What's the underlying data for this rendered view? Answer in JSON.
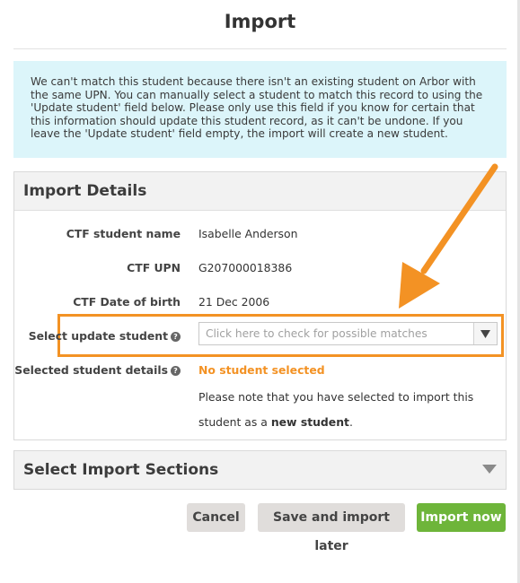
{
  "dialog": {
    "title": "Import",
    "notice": "We can't match this student because there isn't an existing student on Arbor with the same UPN. You can manually select a student to match this record to using the 'Update student' field below. Please only use this field if you know for certain that this information should update this student record, as it can't be undone. If you leave the 'Update student' field empty, the import will create a new student."
  },
  "details": {
    "heading": "Import Details",
    "rows": [
      {
        "label": "CTF student name",
        "value": "Isabelle Anderson"
      },
      {
        "label": "CTF UPN",
        "value": "G207000018386"
      },
      {
        "label": "CTF Date of birth",
        "value": "21 Dec 2006"
      }
    ],
    "update_student": {
      "label": "Select update student",
      "placeholder": "Click here to check for possible matches"
    },
    "selected": {
      "label": "Selected student details",
      "value": "No student selected",
      "note_prefix": "Please note that you have selected to import this student as a ",
      "note_bold": "new student",
      "note_suffix": "."
    }
  },
  "sections": {
    "heading": "Select Import Sections"
  },
  "buttons": {
    "cancel": "Cancel",
    "save_later": "Save and import later",
    "import_now": "Import now"
  },
  "colors": {
    "notice_bg": "#dcf5fa",
    "accent_orange": "#f39224",
    "primary_green": "#6eb53a",
    "secondary_button": "#e0dddb"
  },
  "icons": {
    "help": "question-circle-icon",
    "dropdown": "triangle-down-icon",
    "chevron": "chevron-down-icon"
  }
}
